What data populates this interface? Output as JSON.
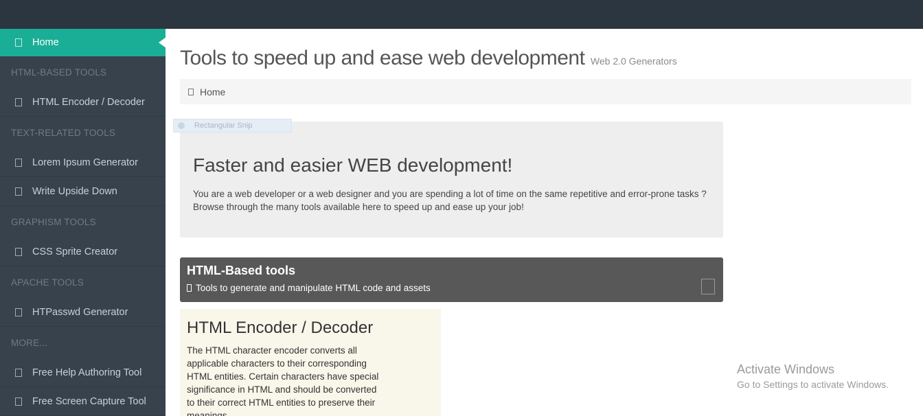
{
  "sidebar": {
    "home": "Home",
    "sections": [
      {
        "title": "HTML-BASED TOOLS",
        "items": [
          "HTML Encoder / Decoder"
        ]
      },
      {
        "title": "TEXT-RELATED TOOLS",
        "items": [
          "Lorem Ipsum Generator",
          "Write Upside Down"
        ]
      },
      {
        "title": "GRAPHISM TOOLS",
        "items": [
          "CSS Sprite Creator"
        ]
      },
      {
        "title": "APACHE TOOLS",
        "items": [
          "HTPasswd Generator"
        ]
      },
      {
        "title": "MORE...",
        "items": [
          "Free Help Authoring Tool",
          "Free Screen Capture Tool"
        ]
      }
    ]
  },
  "header": {
    "title": "Tools to speed up and ease web development",
    "subtitle": "Web 2.0 Generators"
  },
  "breadcrumb": {
    "home": "Home"
  },
  "snip_overlay": {
    "label": "Rectangular Snip"
  },
  "jumbotron": {
    "heading": "Faster and easier WEB development!",
    "text": "You are a web developer or a web designer and you are spending a lot of time on the same repetitive and error-prone tasks ? Browse through the many tools available here to speed up and ease up your job!"
  },
  "panel": {
    "title": "HTML-Based tools",
    "subtitle": "Tools to generate and manipulate HTML code and assets"
  },
  "card": {
    "title": "HTML Encoder / Decoder",
    "text": "The HTML character encoder converts all applicable characters to their corresponding HTML entities. Certain characters have special significance in HTML and should be converted to their correct HTML entities to preserve their meanings."
  },
  "watermark": {
    "line1": "Activate Windows",
    "line2": "Go to Settings to activate Windows."
  }
}
